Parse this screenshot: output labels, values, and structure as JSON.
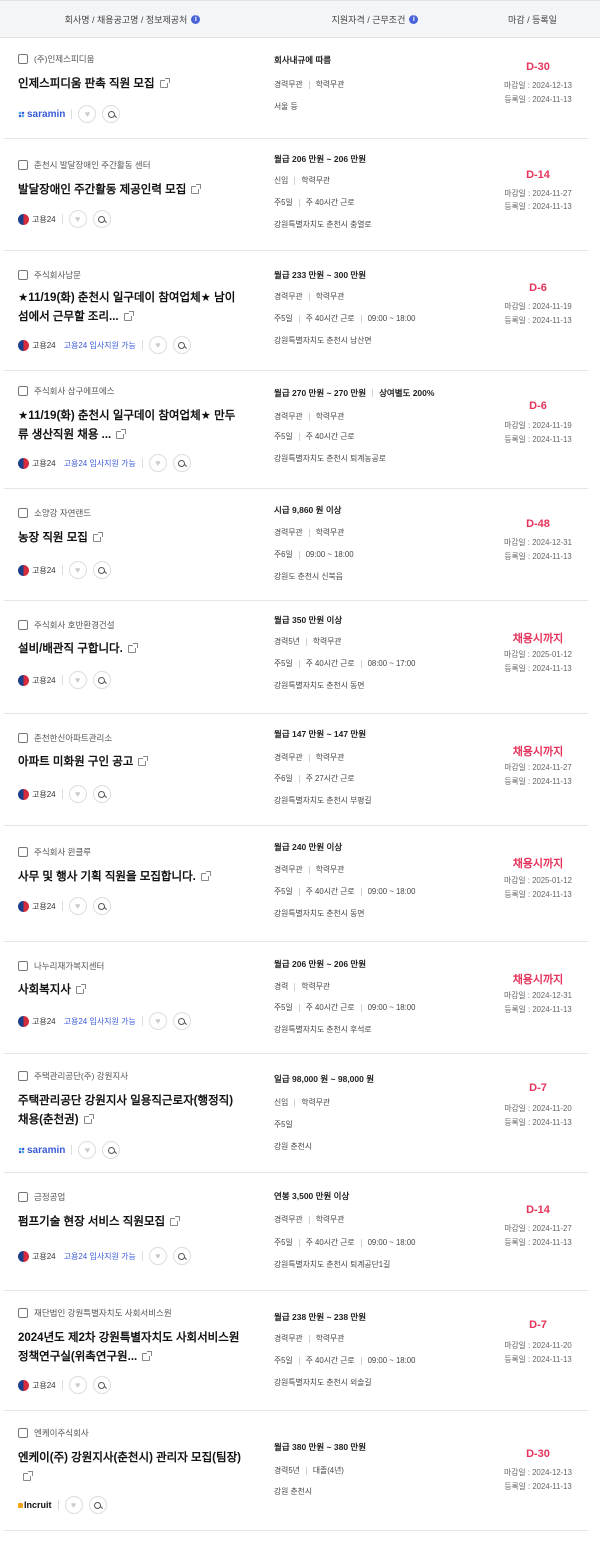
{
  "header": {
    "col1": "회사명 / 채용공고명 / 정보제공처",
    "col2": "지원자격 / 근무조건",
    "col3": "마감 / 등록일"
  },
  "jobs": [
    {
      "company": "(주)인제스피디움",
      "title": "인제스피디움 판촉 직원 모집",
      "source": "saramin",
      "source_label": "saramin",
      "support": "",
      "salary": "회사내규에 따름",
      "salary_extra": "",
      "qual": [
        "경력무관",
        "학력무관"
      ],
      "conditions": [],
      "location": "서울 등",
      "dday": "D-30",
      "deadline": "마감일 : 2024-12-13",
      "registered": "등록일 : 2024-11-13"
    },
    {
      "company": "춘천시 발달장애인 주간활동 센터",
      "title": "발달장애인 주간활동 제공인력 모집",
      "source": "goyong",
      "source_label": "고용24",
      "support": "",
      "salary": "월급 206 만원 ~ 206 만원",
      "salary_extra": "",
      "qual": [
        "신입",
        "학력무관"
      ],
      "conditions": [
        "주5일",
        "주 40시간 근로"
      ],
      "location": "강원특별자치도 춘천시 충열로",
      "dday": "D-14",
      "deadline": "마감일 : 2024-11-27",
      "registered": "등록일 : 2024-11-13"
    },
    {
      "company": "주식회사남문",
      "title": "★11/19(화) 춘천시 일구데이 참여업체★ 남이섬에서 근무할 조리...",
      "source": "goyong",
      "source_label": "고용24",
      "support": "고용24 입사지원 가능",
      "salary": "월급 233 만원 ~ 300 만원",
      "salary_extra": "",
      "qual": [
        "경력무관",
        "학력무관"
      ],
      "conditions": [
        "주5일",
        "주 40시간 근로",
        "09:00 ~ 18:00"
      ],
      "location": "강원특별자치도 춘천시 남산면",
      "dday": "D-6",
      "deadline": "마감일 : 2024-11-19",
      "registered": "등록일 : 2024-11-13"
    },
    {
      "company": "주식회사 삼구에프에스",
      "title": "★11/19(화) 춘천시 일구데이 참여업체★ 만두류 생산직원 채용 ...",
      "source": "goyong",
      "source_label": "고용24",
      "support": "고용24 입사지원 가능",
      "salary": "월급 270 만원 ~ 270 만원",
      "salary_extra": "상여별도 200%",
      "qual": [
        "경력무관",
        "학력무관"
      ],
      "conditions": [
        "주5일",
        "주 40시간 근로"
      ],
      "location": "강원특별자치도 춘천시 퇴계농공로",
      "dday": "D-6",
      "deadline": "마감일 : 2024-11-19",
      "registered": "등록일 : 2024-11-13"
    },
    {
      "company": "소양강 자연랜드",
      "title": "농장 직원 모집",
      "source": "goyong",
      "source_label": "고용24",
      "support": "",
      "salary": "시급 9,860 원 이상",
      "salary_extra": "",
      "qual": [
        "경력무관",
        "학력무관"
      ],
      "conditions": [
        "주6일",
        "09:00 ~ 18:00"
      ],
      "location": "강원도 춘천시 신북읍",
      "dday": "D-48",
      "deadline": "마감일 : 2024-12-31",
      "registered": "등록일 : 2024-11-13"
    },
    {
      "company": "주식회사 호반환경건설",
      "title": "설비/배관직 구합니다.",
      "source": "goyong",
      "source_label": "고용24",
      "support": "",
      "salary": "월급 350 만원 이상",
      "salary_extra": "",
      "qual": [
        "경력5년",
        "학력무관"
      ],
      "conditions": [
        "주5일",
        "주 40시간 근로",
        "08:00 ~ 17:00"
      ],
      "location": "강원특별자치도 춘천시 동면",
      "dday": "채용시까지",
      "deadline": "마감일 : 2025-01-12",
      "registered": "등록일 : 2024-11-13"
    },
    {
      "company": "춘천한신아파트관리소",
      "title": "아파트 미화원 구인 공고",
      "source": "goyong",
      "source_label": "고용24",
      "support": "",
      "salary": "월급 147 만원 ~ 147 만원",
      "salary_extra": "",
      "qual": [
        "경력무관",
        "학력무관"
      ],
      "conditions": [
        "주6일",
        "주 27시간 근로"
      ],
      "location": "강원특별자치도 춘천시 부평길",
      "dday": "채용시까지",
      "deadline": "마감일 : 2024-11-27",
      "registered": "등록일 : 2024-11-13"
    },
    {
      "company": "주식회사 윈클루",
      "title": "사무 및 행사 기획 직원을 모집합니다.",
      "source": "goyong",
      "source_label": "고용24",
      "support": "",
      "salary": "월급 240 만원 이상",
      "salary_extra": "",
      "qual": [
        "경력무관",
        "학력무관"
      ],
      "conditions": [
        "주5일",
        "주 40시간 근로",
        "09:00 ~ 18:00"
      ],
      "location": "강원특별자치도 춘천시 동면",
      "dday": "채용시까지",
      "deadline": "마감일 : 2025-01-12",
      "registered": "등록일 : 2024-11-13"
    },
    {
      "company": "나누리재가복지센터",
      "title": "사회복지사",
      "source": "goyong",
      "source_label": "고용24",
      "support": "고용24 입사지원 가능",
      "salary": "월급 206 만원 ~ 206 만원",
      "salary_extra": "",
      "qual": [
        "경력",
        "학력무관"
      ],
      "conditions": [
        "주5일",
        "주 40시간 근로",
        "09:00 ~ 18:00"
      ],
      "location": "강원특별자치도 춘천시 후석로",
      "dday": "채용시까지",
      "deadline": "마감일 : 2024-12-31",
      "registered": "등록일 : 2024-11-13"
    },
    {
      "company": "주택관리공단(주) 강원지사",
      "title": "주택관리공단 강원지사 일용직근로자(행정직) 채용(춘천권)",
      "source": "saramin",
      "source_label": "saramin",
      "support": "",
      "salary": "일급 98,000 원 ~ 98,000 원",
      "salary_extra": "",
      "qual": [
        "신입",
        "학력무관"
      ],
      "conditions": [
        "주5일"
      ],
      "location": "강원 춘천시",
      "dday": "D-7",
      "deadline": "마감일 : 2024-11-20",
      "registered": "등록일 : 2024-11-13"
    },
    {
      "company": "금정공업",
      "title": "펌프기술 현장 서비스 직원모집",
      "source": "goyong",
      "source_label": "고용24",
      "support": "고용24 입사지원 가능",
      "salary": "연봉 3,500 만원 이상",
      "salary_extra": "",
      "qual": [
        "경력무관",
        "학력무관"
      ],
      "conditions": [
        "주5일",
        "주 40시간 근로",
        "09:00 ~ 18:00"
      ],
      "location": "강원특별자치도 춘천시 퇴계공단1길",
      "dday": "D-14",
      "deadline": "마감일 : 2024-11-27",
      "registered": "등록일 : 2024-11-13"
    },
    {
      "company": "재단법인 강원특별자치도 사회서비스원",
      "title": "2024년도 제2차 강원특별자치도 사회서비스원 정책연구실(위촉연구원...",
      "source": "goyong",
      "source_label": "고용24",
      "support": "",
      "salary": "월급 238 만원 ~ 238 만원",
      "salary_extra": "",
      "qual": [
        "경력무관",
        "학력무관"
      ],
      "conditions": [
        "주5일",
        "주 40시간 근로",
        "09:00 ~ 18:00"
      ],
      "location": "강원특별자치도 춘천시 외솔길",
      "dday": "D-7",
      "deadline": "마감일 : 2024-11-20",
      "registered": "등록일 : 2024-11-13"
    },
    {
      "company": "엔케이주식회사",
      "title": "엔케이(주) 강원지사(춘천시) 관리자 모집(팀장)",
      "source": "incruit",
      "source_label": "Incruit",
      "support": "",
      "salary": "월급 380 만원 ~ 380 만원",
      "salary_extra": "",
      "qual": [
        "경력5년",
        "대졸(4년)"
      ],
      "conditions": [],
      "location": "강원 춘천시",
      "dday": "D-30",
      "deadline": "마감일 : 2024-12-13",
      "registered": "등록일 : 2024-11-13"
    }
  ]
}
